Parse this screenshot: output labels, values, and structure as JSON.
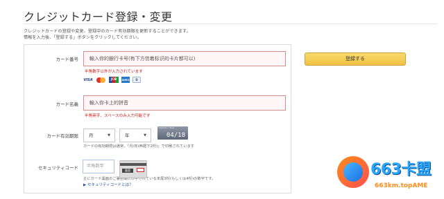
{
  "page": {
    "title": "クレジットカード登録・変更",
    "intro_line1": "クレジットカードの登録や変更、登録中のカード有効期限を更新することができます。",
    "intro_line2": "情報を入力後、「登録する」ボタンをクリックしてください。"
  },
  "form": {
    "card_number": {
      "label": "カード番号",
      "value": "輸入你的銀行卡号(有下方信着标识的卡片都可以)",
      "error": "半角数字以外が入力されています",
      "logos": [
        "VISA",
        "MasterCard",
        "JCB",
        "AMEX",
        "Diners"
      ]
    },
    "card_name": {
      "label": "カード名義",
      "value": "輸入你卡上的拼音",
      "error": "半角英字、スペースのみ入力可能です"
    },
    "expiry": {
      "label": "カード有効期限",
      "month_value": "月",
      "year_value": "年",
      "sample_top": "MONTH / YEAR",
      "sample_value": "04/18",
      "help": "カードの有効期限は通常、「月/年(西暦下2桁)」で印刷されています"
    },
    "security_code": {
      "label": "セキュリティコード",
      "placeholder": "半角数字",
      "card_tag": "裏面",
      "help": "主にカード裏面のご署名欄に印字されている末尾3桁(もしくは4桁)の数字です。",
      "link": "▶ セキュリティコードとは？"
    }
  },
  "actions": {
    "register_label": "登録する"
  },
  "watermark": {
    "title": "663卡盟",
    "subtitle": "663km.topAME"
  },
  "colors": {
    "error": "#d01515",
    "button": "#f0c040",
    "link": "#1a4fa0"
  }
}
